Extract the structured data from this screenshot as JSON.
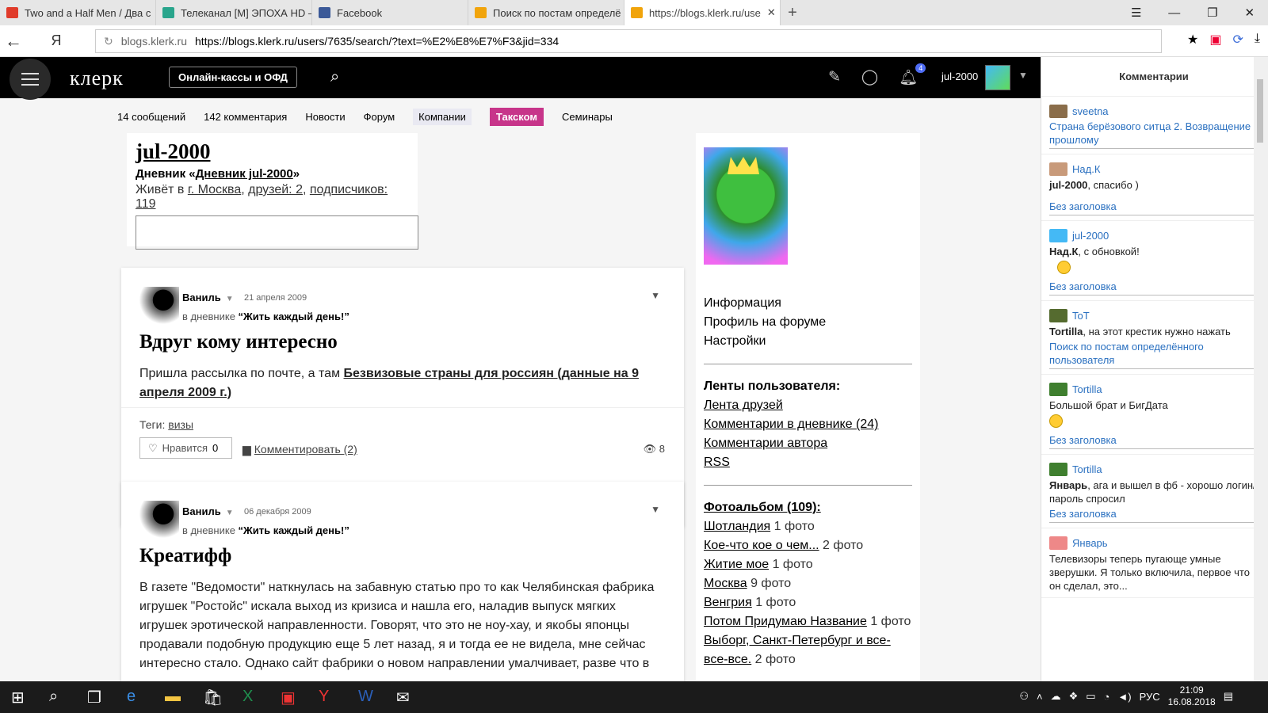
{
  "browser": {
    "tabs": [
      {
        "label": "Two and a Half Men / Два с",
        "color": "#e03b2a"
      },
      {
        "label": "Телеканал [M] ЭПОХА HD –",
        "color": "#29a58c"
      },
      {
        "label": "Facebook",
        "color": "#3b5998"
      },
      {
        "label": "Поиск по постам определё",
        "color": "#f1a40b"
      },
      {
        "label": "https://blogs.klerk.ru/use",
        "color": "#f1a40b"
      }
    ],
    "domain": "blogs.klerk.ru",
    "url": "https://blogs.klerk.ru/users/7635/search/?text=%E2%E8%E7%F3&jid=334"
  },
  "header": {
    "logo": "клерк",
    "cta": "Онлайн-кассы и ОФД",
    "notifications": "4",
    "username": "jul-2000"
  },
  "subnav": [
    "14 сообщений",
    "142 комментария",
    "Новости",
    "Форум",
    "Компании",
    "Такском",
    "Семинары"
  ],
  "profile": {
    "name": "jul-2000",
    "diary_prefix": "Дневник «",
    "diary_name": "Дневник jul-2000",
    "diary_suffix": "»",
    "lives_prefix": "Живёт в ",
    "city": "г. Москва",
    "friends": "друзей: 2",
    "subscribers": "подписчиков: 119"
  },
  "posts": [
    {
      "author": "Ваниль",
      "date": "21 апреля 2009",
      "in_prefix": "в дневнике ",
      "diary": "“Жить каждый день!”",
      "title": "Вдруг кому интересно",
      "text_prefix": "Пришла рассылка по почте, а там ",
      "text_link": "Безвизовые страны для россиян (данные на 9 апреля 2009 г.)",
      "tags_label": "Теги: ",
      "tag": "визы",
      "like_label": "Нравится",
      "likes": "0",
      "comment_label": "Комментировать (2)",
      "views": "8"
    },
    {
      "author": "Ваниль",
      "date": "06 декабря 2009",
      "in_prefix": "в дневнике ",
      "diary": "“Жить каждый день!”",
      "title": "Креатифф",
      "text": "В газете \"Ведомости\" наткнулась на забавную статью про то как Челябинская фабрика игрушек \"Ростойс\" искала выход из кризиса и нашла его, наладив выпуск мягких игрушек эротической направленности. Говорят, что это не ноу-хау, и якобы японцы продавали подобную продукцию еще 5 лет назад, я и тогда ее не видела, мне сейчас интересно стало. Однако сайт фабрики о новом направлении умалчивает, разве что в"
    }
  ],
  "sidebar": {
    "menu": [
      "Информация",
      "Профиль на форуме",
      "Настройки"
    ],
    "feeds_title": "Ленты пользователя:",
    "feeds": [
      "Лента друзей",
      "Комментарии в дневнике (24)",
      "Комментарии автора",
      "RSS"
    ],
    "album_title": "Фотоальбом (109):",
    "album": [
      {
        "name": "Шотландия",
        "count": " 1 фото"
      },
      {
        "name": "Кое-что кое о чем...",
        "count": " 2 фото"
      },
      {
        "name": "Житие мое",
        "count": " 1 фото"
      },
      {
        "name": "Москва",
        "count": " 9 фото"
      },
      {
        "name": "Венгрия",
        "count": " 1 фото"
      },
      {
        "name": "Потом Придумаю Название",
        "count": " 1 фото"
      },
      {
        "name": "Выборг, Санкт-Петербург и все-все-все.",
        "count": " 2 фото"
      }
    ]
  },
  "comments_panel": {
    "title": "Комментарии",
    "items": [
      {
        "user": "sveetna",
        "bold": "",
        "text": "",
        "link": "Страна берёзового ситца 2. Возвращение к прошлому",
        "avatar": "#8a6d4a"
      },
      {
        "user": "Над.К",
        "bold": "jul-2000",
        "text": ", спасибо )",
        "link": "Без заголовка",
        "avatar": "#c89a7a"
      },
      {
        "user": "jul-2000",
        "bold": "Над.К",
        "text": ", с обновкой!",
        "link": "Без заголовка",
        "avatar": "#44b9f5"
      },
      {
        "user": "ToT",
        "bold": "Tortilla",
        "text": ", на этот крестик нужно нажать",
        "link": "Поиск по постам определённого пользователя",
        "avatar": "#556b2f"
      },
      {
        "user": "Tortilla",
        "bold": "",
        "text": "Большой брат и БигДата",
        "link": "Без заголовка",
        "avatar": "#3f7f2f"
      },
      {
        "user": "Tortilla",
        "bold": "Январь",
        "text": ", ага и вышел в фб - хорошо логин/ пароль спросил",
        "link": "Без заголовка",
        "avatar": "#3f7f2f"
      },
      {
        "user": "Январь",
        "bold": "",
        "text": "Телевизоры теперь пугающе умные зверушки. Я только включила, первое что он сделал, это...",
        "link": "",
        "avatar": "#e88"
      }
    ]
  },
  "taskbar": {
    "lang": "РУС",
    "time": "21:09",
    "date": "16.08.2018"
  }
}
